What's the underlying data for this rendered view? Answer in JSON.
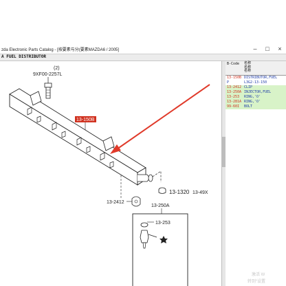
{
  "window": {
    "title": "zda Electronic Parts Catalog - [按要素与分(要素MAZDA6 / 2005]",
    "menu": "A  FUEL DISTRIBUTOR",
    "min": "–",
    "max": "□",
    "close": "×"
  },
  "diagram": {
    "labels": {
      "bolt_qty": "(2)",
      "bolt_code": "9XF00-2257L",
      "hilite": "13-150B",
      "clip_code": "13-2412",
      "ring_code": "13-1320",
      "ring_suffix": "13-49X",
      "injector_code": "13-250A",
      "ring2_code": "13-253"
    }
  },
  "panel": {
    "header": {
      "col_code": "B-Code",
      "col_desc_lines": [
        "名称",
        "名称",
        "名称"
      ]
    },
    "rows": [
      {
        "code": "13-150B",
        "desc": "DISTRIBUTOR,FUEL"
      },
      {
        "code": "",
        "desc": "L3G2-13-150",
        "pin": "P"
      },
      {
        "code": "13-2412",
        "desc": "CLIP"
      },
      {
        "code": "13-250A",
        "desc": "INJECTOR,FUEL"
      },
      {
        "code": "13-253",
        "desc": "RING,'O'"
      },
      {
        "code": "13-281A",
        "desc": "RING,'O'"
      },
      {
        "code": "99-60I",
        "desc": "BOLT"
      }
    ]
  },
  "watermark": {
    "line1": "激活 W",
    "line2": "转到“设置"
  },
  "colors": {
    "accent_red": "#d0311f",
    "text_blue": "#1f3ca8",
    "row_green": "#d8f3c8"
  }
}
